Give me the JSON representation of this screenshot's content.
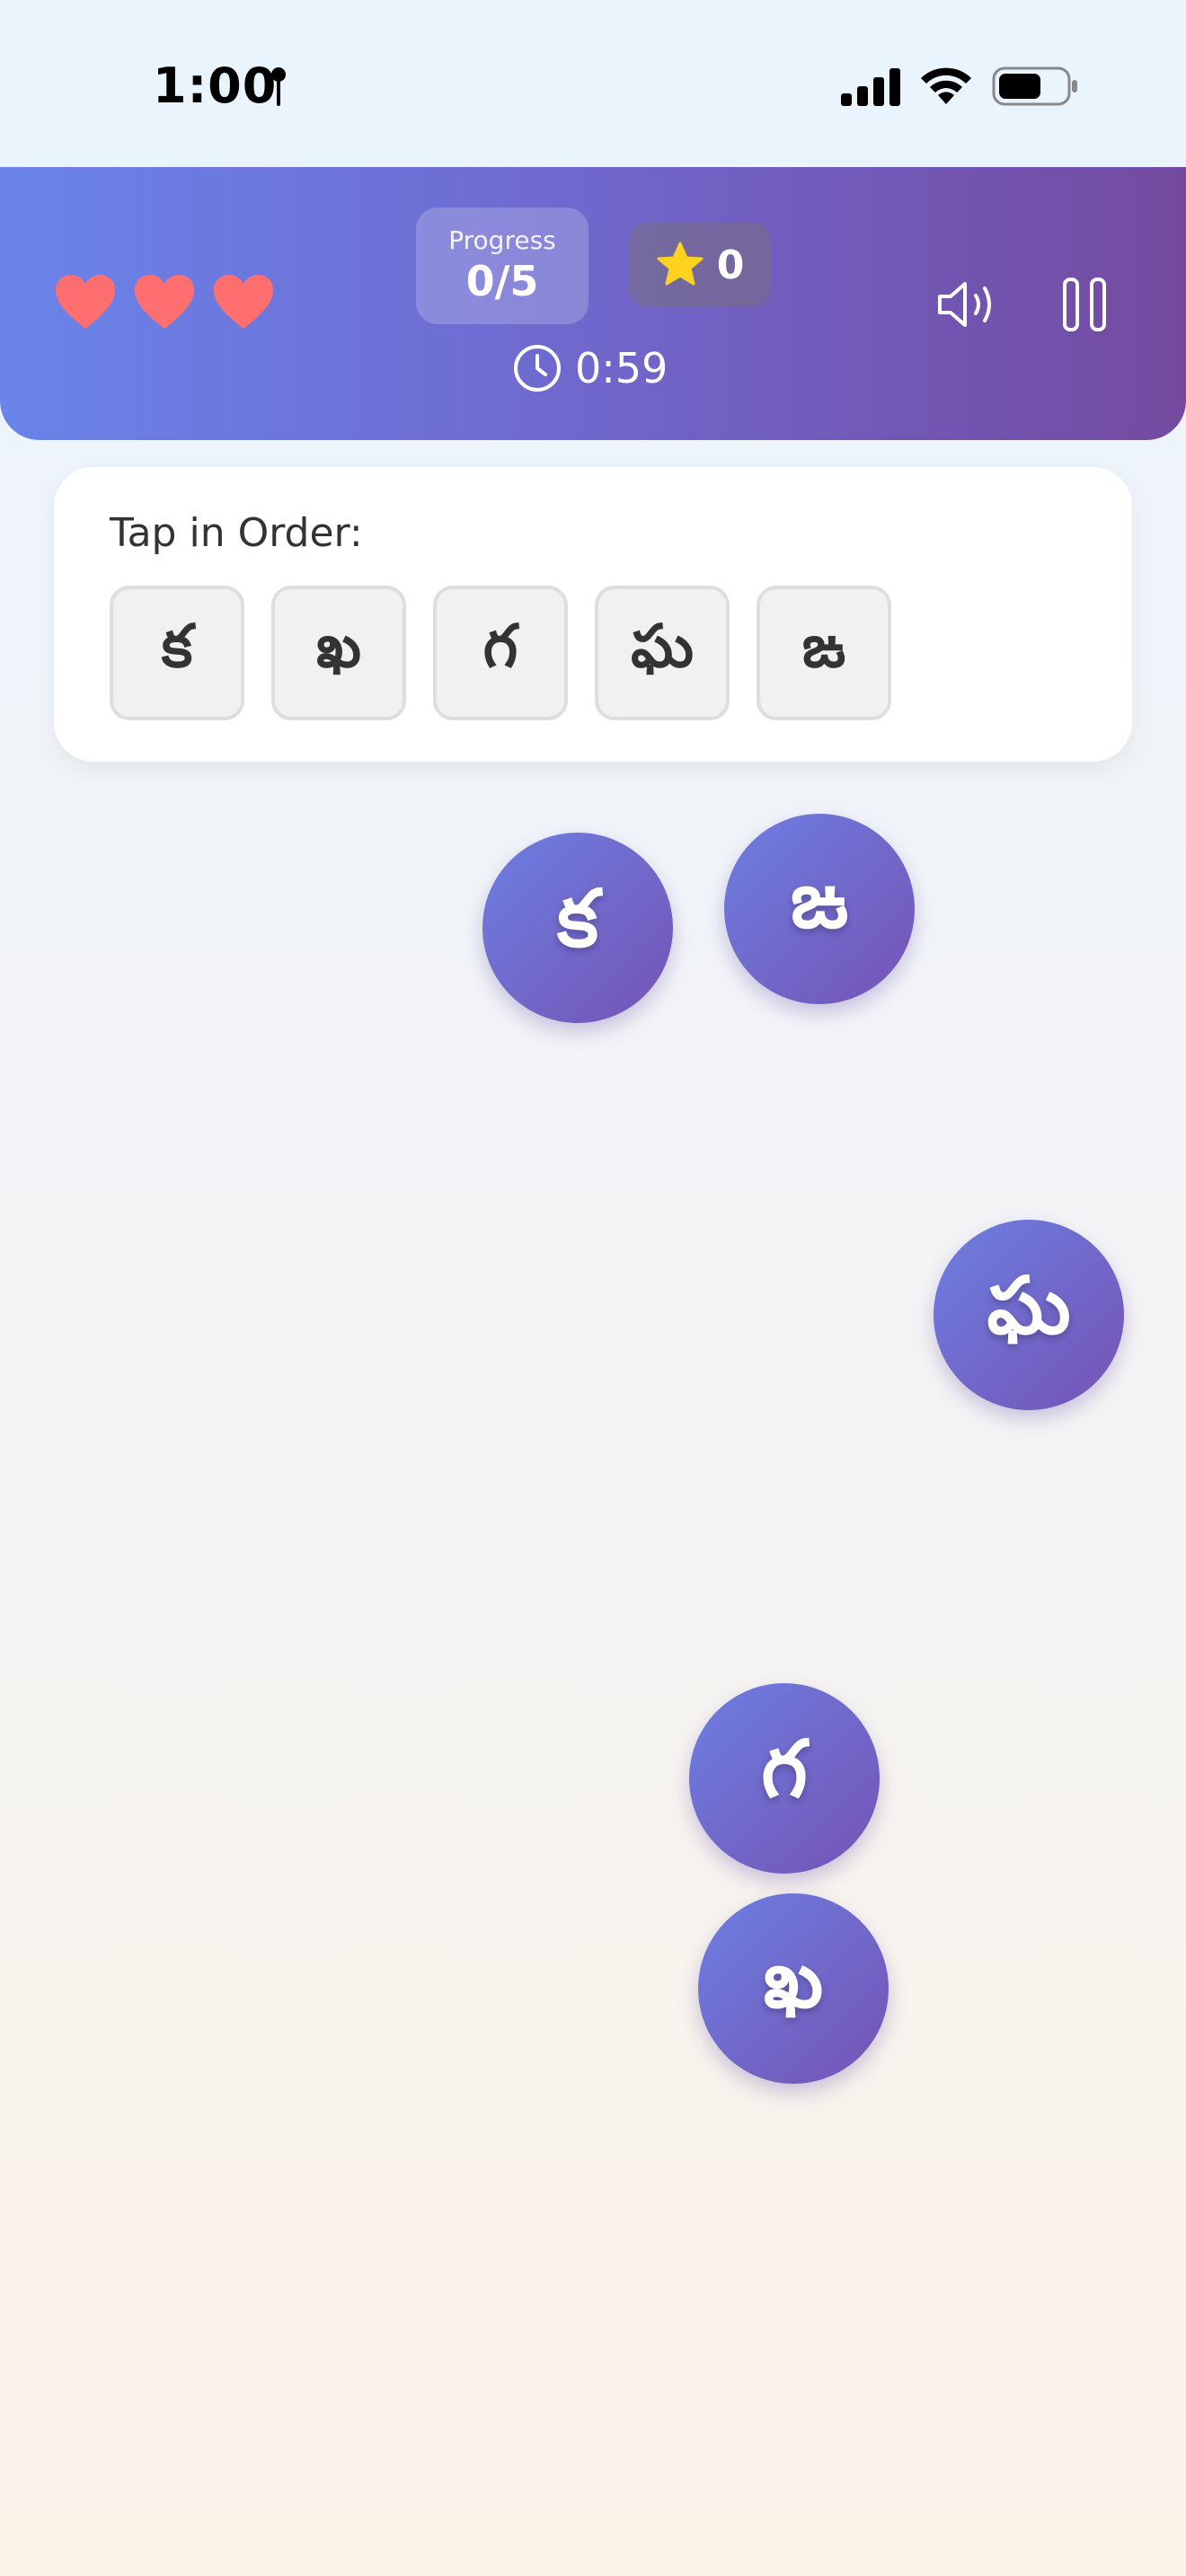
{
  "status_bar": {
    "time": "1:00"
  },
  "header": {
    "lives": 3,
    "progress_label": "Progress",
    "progress_value": "0/5",
    "score": "0",
    "timer": "0:59"
  },
  "order_card": {
    "title": "Tap in Order:",
    "letters": [
      "క",
      "ఖ",
      "గ",
      "ఘ",
      "ఙ"
    ]
  },
  "bubbles": {
    "ka": "క",
    "ja": "ఙ",
    "gha": "ఘ",
    "ga": "గ",
    "kha": "ఖ"
  },
  "colors": {
    "header_start": "#6a84ea",
    "header_end": "#744aa0",
    "heart": "#ff6f6f",
    "star": "#ffd21f",
    "bubble_start": "#6c7fe2",
    "bubble_end": "#7553b4"
  }
}
